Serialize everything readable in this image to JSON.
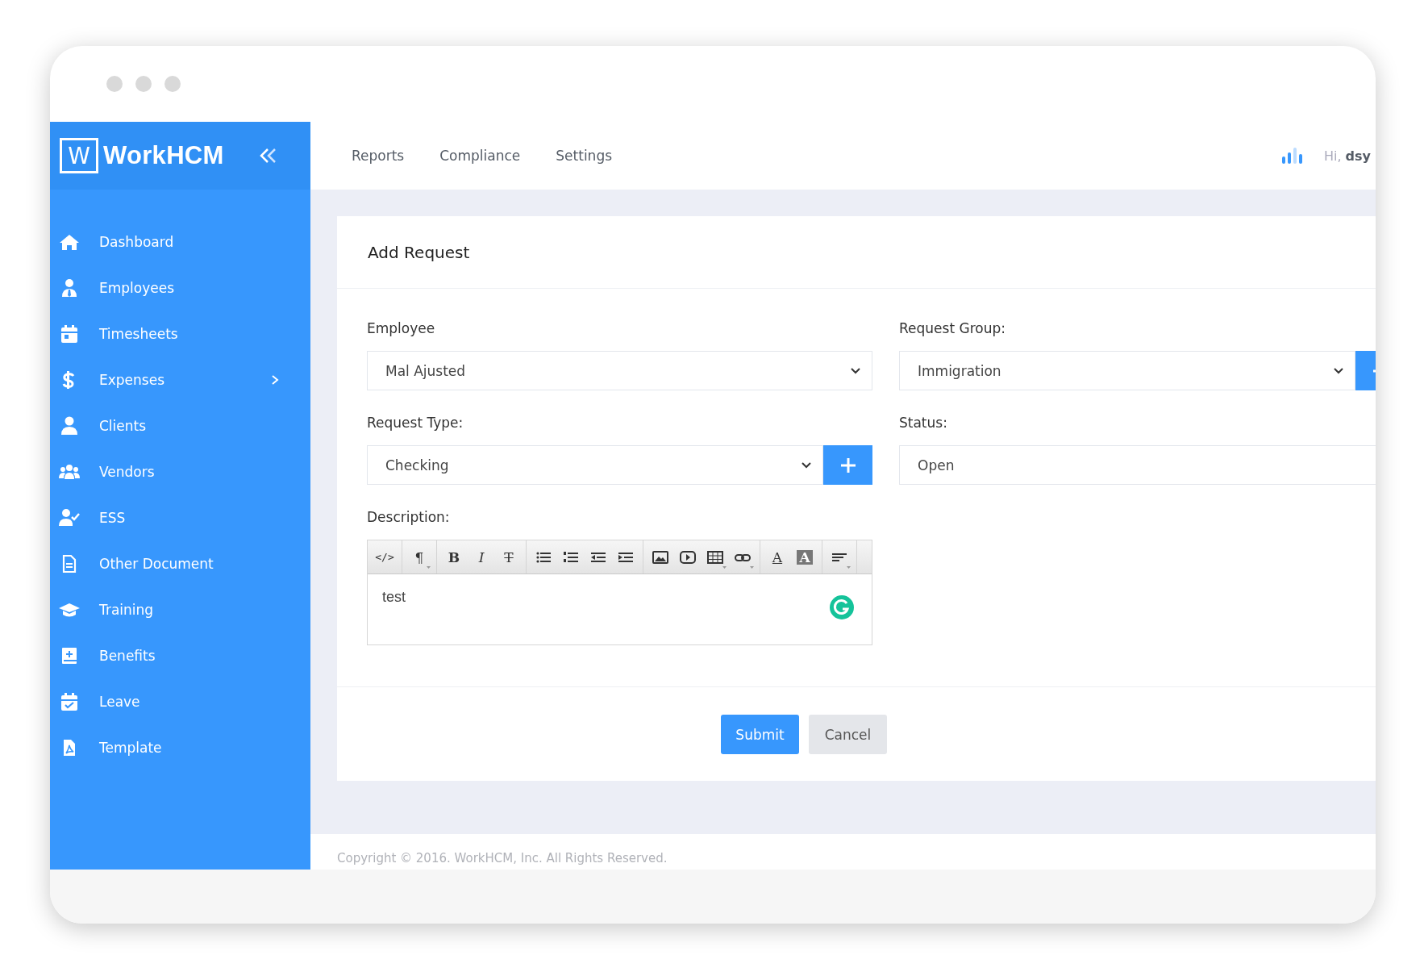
{
  "brand": {
    "logo_letter": "W",
    "name": "WorkHCM"
  },
  "sidebar": {
    "items": [
      {
        "kind": "home",
        "label": "Dashboard",
        "expandable": false
      },
      {
        "kind": "user-tie",
        "label": "Employees",
        "expandable": false
      },
      {
        "kind": "calendar",
        "label": "Timesheets",
        "expandable": false
      },
      {
        "kind": "dollar",
        "label": "Expenses",
        "expandable": true
      },
      {
        "kind": "user",
        "label": "Clients",
        "expandable": false
      },
      {
        "kind": "users",
        "label": "Vendors",
        "expandable": false
      },
      {
        "kind": "user-check",
        "label": "ESS",
        "expandable": false
      },
      {
        "kind": "file",
        "label": "Other Document",
        "expandable": false
      },
      {
        "kind": "cap",
        "label": "Training",
        "expandable": false
      },
      {
        "kind": "book-plus",
        "label": "Benefits",
        "expandable": false
      },
      {
        "kind": "calendar-check",
        "label": "Leave",
        "expandable": false
      },
      {
        "kind": "pdf",
        "label": "Template",
        "expandable": false
      }
    ]
  },
  "topnav": {
    "items": [
      "Reports",
      "Compliance",
      "Settings"
    ],
    "greeting": "Hi, **dsy**"
  },
  "form": {
    "title": "Add Request",
    "fields": [
      {
        "label": "Employee",
        "kind": "select",
        "value": "Mal Ajusted",
        "add_button": false
      },
      {
        "label": "Request Group:",
        "kind": "select",
        "value": "Immigration",
        "add_button": true
      },
      {
        "label": "Request Type:",
        "kind": "select",
        "value": "Checking",
        "add_button": true
      },
      {
        "label": "Status:",
        "kind": "text",
        "value": "Open",
        "add_button": false
      }
    ],
    "description": {
      "label": "Description:",
      "text": "test",
      "toolbar": [
        [
          {
            "kind": "code",
            "label": "</>",
            "dropdown": false
          }
        ],
        [
          {
            "kind": "paragraph",
            "label": "¶",
            "dropdown": true
          }
        ],
        [
          {
            "kind": "bold",
            "label": "B",
            "dropdown": false
          },
          {
            "kind": "italic",
            "label": "I",
            "dropdown": false
          },
          {
            "kind": "strike",
            "label": "T",
            "dropdown": false
          }
        ],
        [
          {
            "kind": "ul",
            "dropdown": false
          },
          {
            "kind": "ol",
            "dropdown": false
          },
          {
            "kind": "outdent",
            "dropdown": false
          },
          {
            "kind": "indent",
            "dropdown": false
          }
        ],
        [
          {
            "kind": "picture",
            "dropdown": false
          },
          {
            "kind": "video",
            "dropdown": false
          },
          {
            "kind": "table",
            "dropdown": true
          },
          {
            "kind": "link",
            "dropdown": true
          }
        ],
        [
          {
            "kind": "fontcolor",
            "label": "A",
            "dropdown": false
          },
          {
            "kind": "bgcolor",
            "label": "A",
            "dropdown": false
          }
        ],
        [
          {
            "kind": "align",
            "dropdown": true
          }
        ]
      ]
    },
    "buttons": [
      {
        "label": "Submit",
        "kind": "primary"
      },
      {
        "label": "Cancel",
        "kind": "secondary"
      }
    ]
  },
  "footer": "Copyright © 2016. WorkHCM, Inc. All Rights Reserved."
}
